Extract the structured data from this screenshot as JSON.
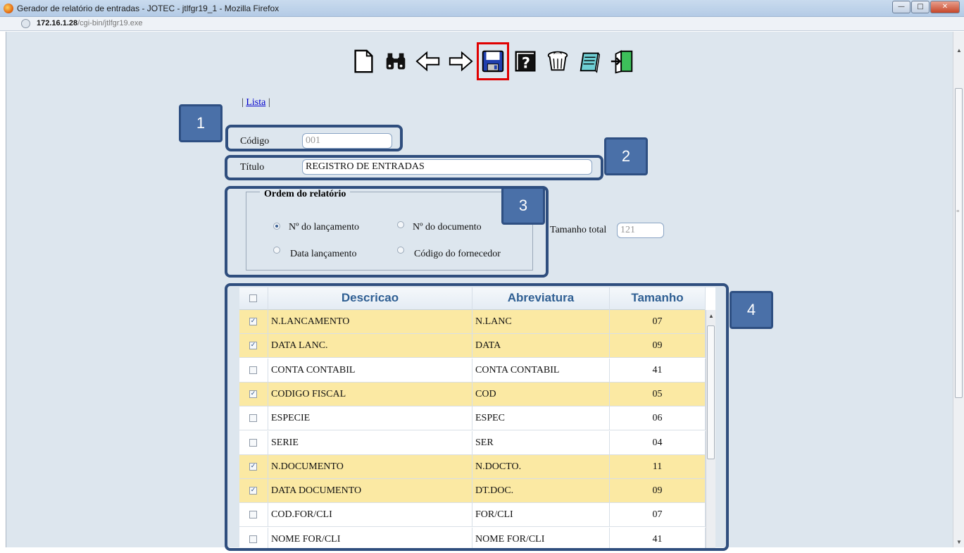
{
  "window": {
    "title": "Gerador de relatório de entradas - JOTEC - jtlfgr19_1 - Mozilla Firefox",
    "url_host": "172.16.1.28",
    "url_path": "/cgi-bin/jtlfgr19.exe"
  },
  "toolbar": {
    "buttons": [
      {
        "name": "new-document-icon"
      },
      {
        "name": "binoculars-search-icon"
      },
      {
        "name": "arrow-left-icon"
      },
      {
        "name": "arrow-right-icon"
      },
      {
        "name": "save-floppy-icon",
        "active": true
      },
      {
        "name": "help-icon"
      },
      {
        "name": "trash-icon"
      },
      {
        "name": "notebook-icon"
      },
      {
        "name": "exit-door-icon"
      }
    ]
  },
  "nav": {
    "pre": "|",
    "lista": "Lista",
    "post": "|"
  },
  "callouts": [
    "1",
    "2",
    "3",
    "4"
  ],
  "form": {
    "codigo_label": "Código",
    "codigo_value": "001",
    "titulo_label": "Título",
    "titulo_value": "REGISTRO DE ENTRADAS",
    "tamanho_label": "Tamanho total",
    "tamanho_value": "121"
  },
  "ordem": {
    "legend": "Ordem do relatório",
    "options": [
      {
        "label": "Nº do lançamento",
        "checked": true
      },
      {
        "label": "Nº do documento",
        "checked": false
      },
      {
        "label": "Data lançamento",
        "checked": false
      },
      {
        "label": "Código do fornecedor",
        "checked": false
      }
    ]
  },
  "table": {
    "headers": [
      "Descricao",
      "Abreviatura",
      "Tamanho"
    ],
    "rows": [
      {
        "checked": true,
        "descricao": "N.LANCAMENTO",
        "abreviatura": "N.LANC",
        "tamanho": "07"
      },
      {
        "checked": true,
        "descricao": "DATA LANC.",
        "abreviatura": "DATA",
        "tamanho": "09"
      },
      {
        "checked": false,
        "descricao": "CONTA CONTABIL",
        "abreviatura": "CONTA CONTABIL",
        "tamanho": "41"
      },
      {
        "checked": true,
        "descricao": "CODIGO FISCAL",
        "abreviatura": "COD",
        "tamanho": "05"
      },
      {
        "checked": false,
        "descricao": "ESPECIE",
        "abreviatura": "ESPEC",
        "tamanho": "06"
      },
      {
        "checked": false,
        "descricao": "SERIE",
        "abreviatura": "SER",
        "tamanho": "04"
      },
      {
        "checked": true,
        "descricao": "N.DOCUMENTO",
        "abreviatura": "N.DOCTO.",
        "tamanho": "11"
      },
      {
        "checked": true,
        "descricao": "DATA DOCUMENTO",
        "abreviatura": "DT.DOC.",
        "tamanho": "09"
      },
      {
        "checked": false,
        "descricao": "COD.FOR/CLI",
        "abreviatura": "FOR/CLI",
        "tamanho": "07"
      },
      {
        "checked": false,
        "descricao": "NOME FOR/CLI",
        "abreviatura": "NOME FOR/CLI",
        "tamanho": "41"
      }
    ]
  },
  "colors": {
    "selected_row": "#fbe9a3",
    "callout": "#4a70a8",
    "header_text": "#2f5f93",
    "active_outline": "#e00000"
  }
}
